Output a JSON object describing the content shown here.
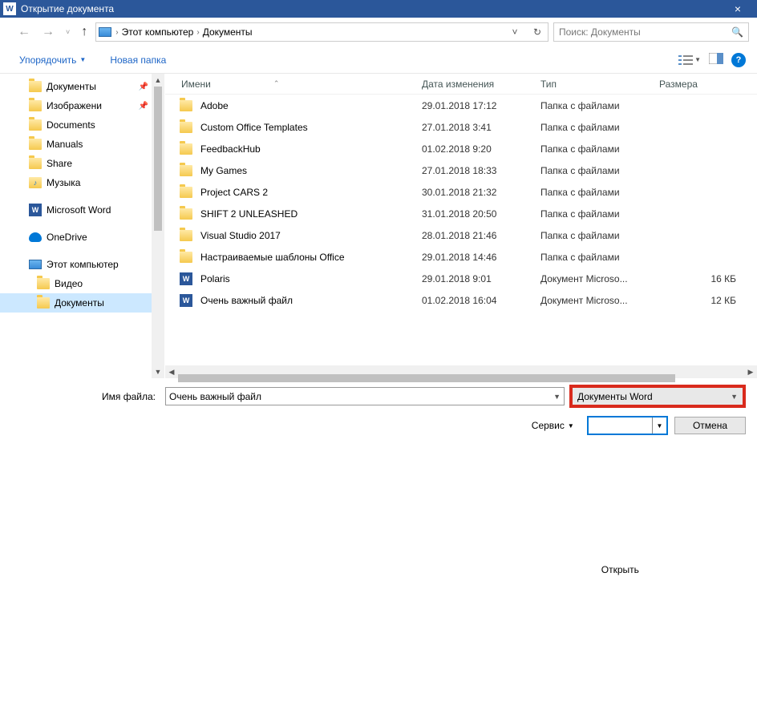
{
  "window": {
    "title": "Открытие документа"
  },
  "breadcrumb": {
    "root_sep": "›",
    "pc": "Этот компьютер",
    "sep": "›",
    "loc": "Документы"
  },
  "search": {
    "placeholder": "Поиск: Документы"
  },
  "toolbar": {
    "organize": "Упорядочить",
    "newfolder": "Новая папка"
  },
  "sidebar": [
    {
      "label": "Документы",
      "icon": "folder",
      "pin": true
    },
    {
      "label": "Изображени",
      "icon": "folder",
      "pin": true
    },
    {
      "label": "Documents",
      "icon": "folder"
    },
    {
      "label": "Manuals",
      "icon": "folder"
    },
    {
      "label": "Share",
      "icon": "folder"
    },
    {
      "label": "Музыка",
      "icon": "music"
    },
    {
      "label": "Microsoft Word",
      "icon": "word",
      "l2": false,
      "gap": true
    },
    {
      "label": "OneDrive",
      "icon": "onedrive",
      "gap": true
    },
    {
      "label": "Этот компьютер",
      "icon": "pc",
      "gap": true
    },
    {
      "label": "Видео",
      "icon": "folder",
      "l2": true
    },
    {
      "label": "Документы",
      "icon": "folder",
      "l2": true,
      "sel": true
    }
  ],
  "columns": {
    "name": "Имени",
    "date": "Дата изменения",
    "type": "Тип",
    "size": "Размера"
  },
  "rows": [
    {
      "name": "Adobe",
      "date": "29.01.2018 17:12",
      "type": "Папка с файлами",
      "size": "",
      "icon": "folder"
    },
    {
      "name": "Custom Office Templates",
      "date": "27.01.2018 3:41",
      "type": "Папка с файлами",
      "size": "",
      "icon": "folder"
    },
    {
      "name": "FeedbackHub",
      "date": "01.02.2018 9:20",
      "type": "Папка с файлами",
      "size": "",
      "icon": "folder"
    },
    {
      "name": "My Games",
      "date": "27.01.2018 18:33",
      "type": "Папка с файлами",
      "size": "",
      "icon": "folder"
    },
    {
      "name": "Project CARS 2",
      "date": "30.01.2018 21:32",
      "type": "Папка с файлами",
      "size": "",
      "icon": "folder"
    },
    {
      "name": "SHIFT 2 UNLEASHED",
      "date": "31.01.2018 20:50",
      "type": "Папка с файлами",
      "size": "",
      "icon": "folder"
    },
    {
      "name": "Visual Studio 2017",
      "date": "28.01.2018 21:46",
      "type": "Папка с файлами",
      "size": "",
      "icon": "folder"
    },
    {
      "name": "Настраиваемые шаблоны Office",
      "date": "29.01.2018 14:46",
      "type": "Папка с файлами",
      "size": "",
      "icon": "folder"
    },
    {
      "name": "Polaris",
      "date": "29.01.2018 9:01",
      "type": "Документ Microso...",
      "size": "16 КБ",
      "icon": "word"
    },
    {
      "name": "Очень важный файл",
      "date": "01.02.2018 16:04",
      "type": "Документ Microso...",
      "size": "12 КБ",
      "icon": "word"
    }
  ],
  "filename": {
    "label": "Имя файла:",
    "value": "Очень важный файл"
  },
  "filetype": {
    "value": "Документы Word"
  },
  "buttons": {
    "service": "Сервис",
    "open": "Открыть",
    "cancel": "Отмена"
  }
}
